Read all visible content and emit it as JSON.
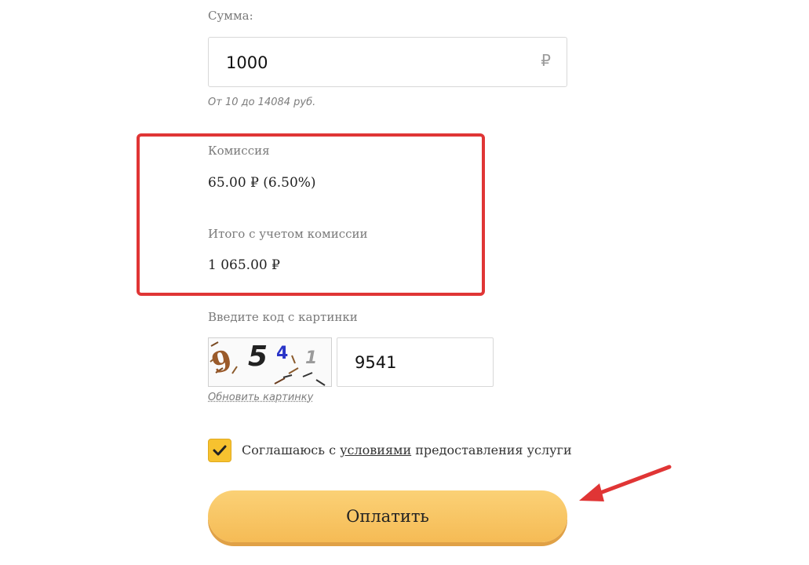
{
  "amount": {
    "label": "Сумма:",
    "value": "1000",
    "currency_symbol": "₽",
    "hint": "От 10 до 14084 руб."
  },
  "commission": {
    "label": "Комиссия",
    "value": "65.00 ₽ (6.50%)",
    "total_label": "Итого с учетом комиссии",
    "total_value": "1 065.00 ₽"
  },
  "captcha": {
    "label": "Введите код с картинки",
    "input_value": "9541",
    "refresh_label": "Обновить картинку",
    "image_chars": [
      "9",
      "5",
      "4",
      "1"
    ]
  },
  "agreement": {
    "checked": true,
    "text_before": "Соглашаюсь с ",
    "link_text": "условиями",
    "text_after": " предоставления услуги"
  },
  "pay_button": {
    "label": "Оплатить"
  },
  "colors": {
    "accent_yellow": "#f7c22f",
    "highlight_red": "#e03535"
  }
}
